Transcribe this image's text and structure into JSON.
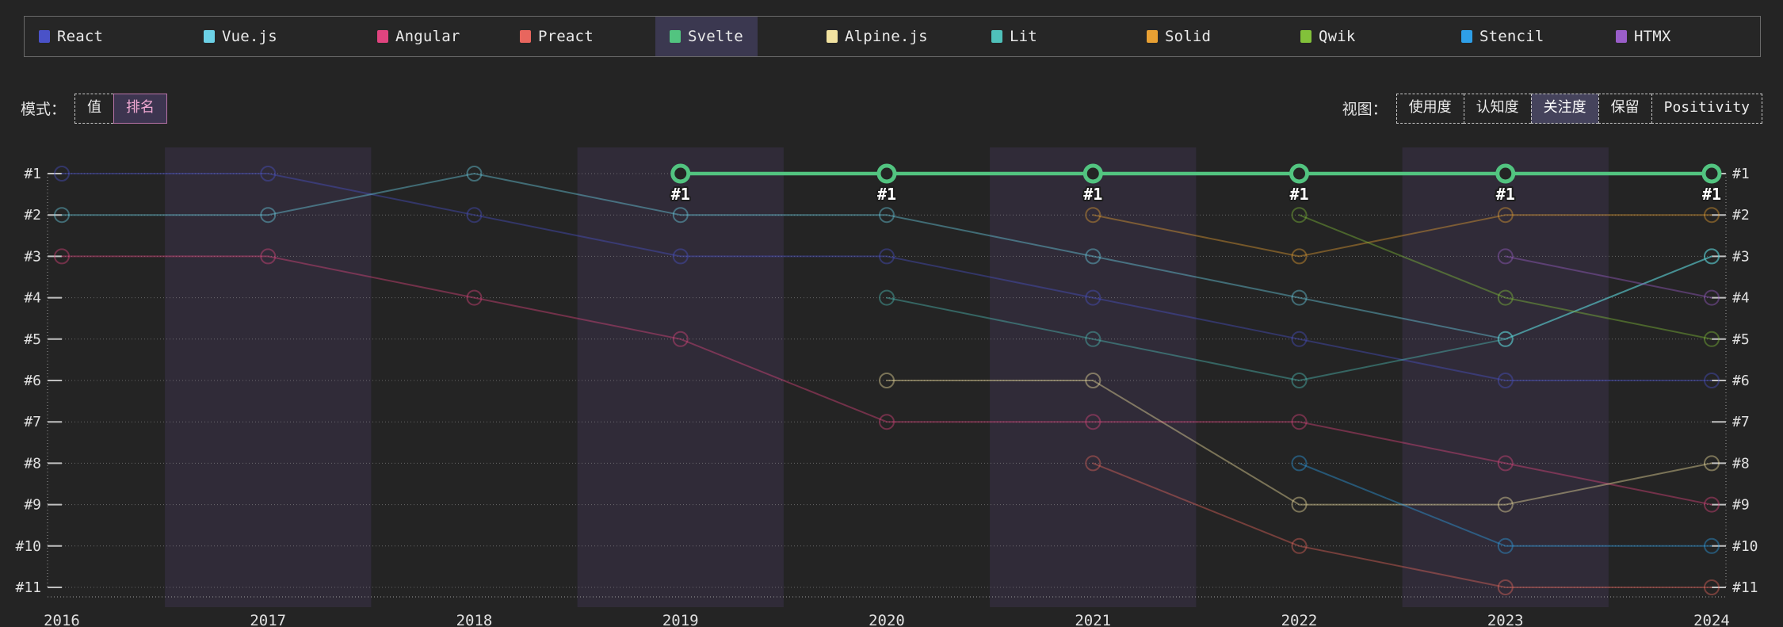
{
  "legend": {
    "items": [
      {
        "label": "React",
        "color": "#4a52c8",
        "active": false
      },
      {
        "label": "Vue.js",
        "color": "#6cd1e6",
        "active": false
      },
      {
        "label": "Angular",
        "color": "#e0447f",
        "active": false
      },
      {
        "label": "Preact",
        "color": "#e8665e",
        "active": false
      },
      {
        "label": "Svelte",
        "color": "#52c480",
        "active": true
      },
      {
        "label": "Alpine.js",
        "color": "#f2e2a0",
        "active": false
      },
      {
        "label": "Lit",
        "color": "#4fc1ba",
        "active": false
      },
      {
        "label": "Solid",
        "color": "#e8a033",
        "active": false
      },
      {
        "label": "Qwik",
        "color": "#82c13a",
        "active": false
      },
      {
        "label": "Stencil",
        "color": "#2e9fe8",
        "active": false
      },
      {
        "label": "HTMX",
        "color": "#9a5ec9",
        "active": false
      }
    ]
  },
  "controls": {
    "mode": {
      "label": "模式：",
      "options": [
        {
          "label": "值",
          "selected": false
        },
        {
          "label": "排名",
          "selected": true
        }
      ]
    },
    "view": {
      "label": "视图：",
      "options": [
        {
          "label": "使用度",
          "selected": false
        },
        {
          "label": "认知度",
          "selected": false
        },
        {
          "label": "关注度",
          "selected": true
        },
        {
          "label": "保留",
          "selected": false
        },
        {
          "label": "Positivity",
          "selected": false
        }
      ]
    }
  },
  "chart_data": {
    "type": "line",
    "title": "",
    "xlabel": "",
    "ylabel": "",
    "mode": "rank",
    "grid": true,
    "legend_position": "top",
    "y_inverted": true,
    "x": [
      2016,
      2017,
      2018,
      2019,
      2020,
      2021,
      2022,
      2023,
      2024
    ],
    "categories": [
      "2016",
      "2017",
      "2018",
      "2019",
      "2020",
      "2021",
      "2022",
      "2023",
      "2024"
    ],
    "y_ticks": [
      "#1",
      "#2",
      "#3",
      "#4",
      "#5",
      "#6",
      "#7",
      "#8",
      "#9",
      "#10",
      "#11"
    ],
    "ylim": [
      1,
      11
    ],
    "highlighted_series": "Svelte",
    "point_labels": {
      "series": "Svelte",
      "values": [
        "#1",
        "#1",
        "#1",
        "#1",
        "#1",
        "#1"
      ],
      "at_x": [
        2019,
        2020,
        2021,
        2022,
        2023,
        2024
      ]
    },
    "series": [
      {
        "name": "React",
        "color": "#4a52c8",
        "values": [
          1,
          1,
          2,
          3,
          3,
          4,
          5,
          6,
          6
        ]
      },
      {
        "name": "Vue.js",
        "color": "#6cd1e6",
        "values": [
          2,
          2,
          1,
          2,
          2,
          3,
          4,
          5,
          3
        ]
      },
      {
        "name": "Angular",
        "color": "#e0447f",
        "values": [
          3,
          3,
          4,
          5,
          7,
          7,
          7,
          8,
          9
        ]
      },
      {
        "name": "Preact",
        "color": "#e8665e",
        "values": [
          null,
          null,
          null,
          null,
          null,
          8,
          10,
          11,
          11
        ]
      },
      {
        "name": "Svelte",
        "color": "#52c480",
        "values": [
          null,
          null,
          null,
          1,
          1,
          1,
          1,
          1,
          1
        ]
      },
      {
        "name": "Alpine.js",
        "color": "#f2e2a0",
        "values": [
          null,
          null,
          null,
          null,
          6,
          6,
          9,
          9,
          8
        ]
      },
      {
        "name": "Lit",
        "color": "#4fc1ba",
        "values": [
          null,
          null,
          null,
          null,
          4,
          5,
          6,
          5,
          3
        ]
      },
      {
        "name": "Solid",
        "color": "#e8a033",
        "values": [
          null,
          null,
          null,
          null,
          null,
          2,
          3,
          2,
          2
        ]
      },
      {
        "name": "Qwik",
        "color": "#82c13a",
        "values": [
          null,
          null,
          null,
          null,
          null,
          null,
          2,
          4,
          5
        ]
      },
      {
        "name": "Stencil",
        "color": "#2e9fe8",
        "values": [
          null,
          null,
          null,
          null,
          null,
          null,
          8,
          10,
          10
        ]
      },
      {
        "name": "HTMX",
        "color": "#9a5ec9",
        "values": [
          null,
          null,
          null,
          null,
          null,
          null,
          null,
          3,
          4
        ]
      }
    ]
  }
}
